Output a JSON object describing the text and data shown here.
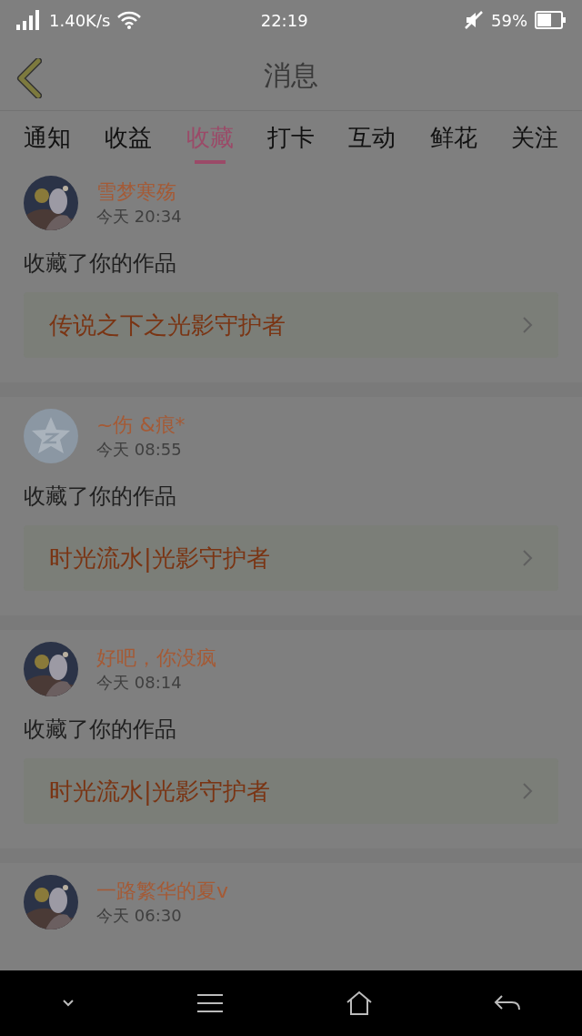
{
  "status_bar": {
    "speed": "1.40K/s",
    "time": "22:19",
    "battery": "59%"
  },
  "header": {
    "title": "消息"
  },
  "tabs": [
    {
      "label": "通知",
      "selected": false
    },
    {
      "label": "收益",
      "selected": false
    },
    {
      "label": "收藏",
      "selected": true
    },
    {
      "label": "打卡",
      "selected": false
    },
    {
      "label": "互动",
      "selected": false
    },
    {
      "label": "鲜花",
      "selected": false
    },
    {
      "label": "关注",
      "selected": false
    }
  ],
  "messages": [
    {
      "name": "雪梦寒殇",
      "time": "今天 20:34",
      "text": "收藏了你的作品",
      "work": "传说之下之光影守护者"
    },
    {
      "avatar": {
        "kind": "default"
      },
      "name": "~伤 &痕*",
      "time": "今天 08:55",
      "text": "收藏了你的作品",
      "work": "时光流水|光影守护者"
    },
    {
      "name": "好吧，你没疯",
      "time": "今天 08:14",
      "text": "收藏了你的作品",
      "work": "时光流水|光影守护者"
    },
    {
      "name": "一路繁华的夏v",
      "time": "今天 06:30"
    }
  ]
}
